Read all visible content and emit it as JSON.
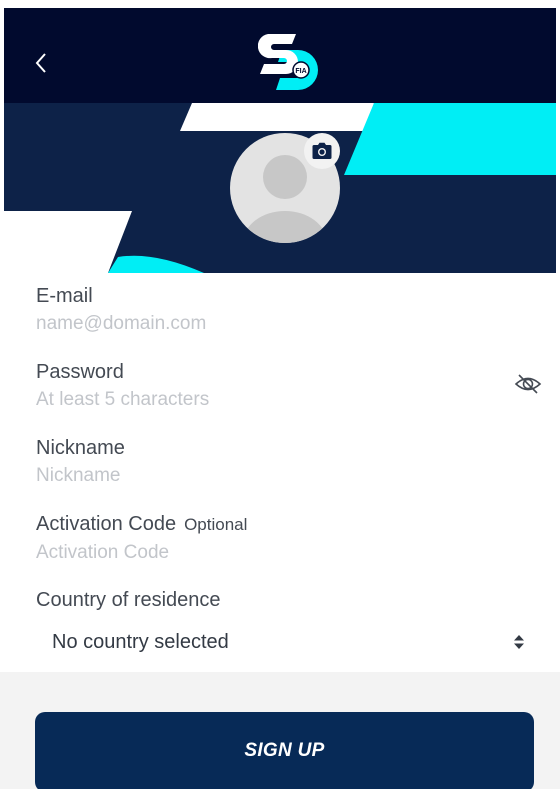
{
  "header": {
    "back_icon": "chevron-left-icon",
    "logo_icon": "sd-logo-icon",
    "logo_badge_text": "FIA"
  },
  "profile": {
    "avatar_icon": "avatar-placeholder-icon",
    "camera_icon": "camera-icon"
  },
  "form": {
    "email": {
      "label": "E-mail",
      "placeholder": "name@domain.com",
      "value": ""
    },
    "password": {
      "label": "Password",
      "placeholder": "At least 5 characters",
      "value": "",
      "toggle_icon": "eye-off-icon"
    },
    "nickname": {
      "label": "Nickname",
      "placeholder": "Nickname",
      "value": ""
    },
    "activation_code": {
      "label": "Activation Code",
      "optional_label": "Optional",
      "placeholder": "Activation Code",
      "value": ""
    },
    "country": {
      "label": "Country of residence",
      "selected": "No country selected",
      "icon": "sort-arrows-icon"
    }
  },
  "actions": {
    "signup_label": "SIGN UP"
  },
  "colors": {
    "header_bg": "#010a2e",
    "banner_bg": "#0d2248",
    "accent_cyan": "#00eef5",
    "button_bg": "#072a57"
  }
}
